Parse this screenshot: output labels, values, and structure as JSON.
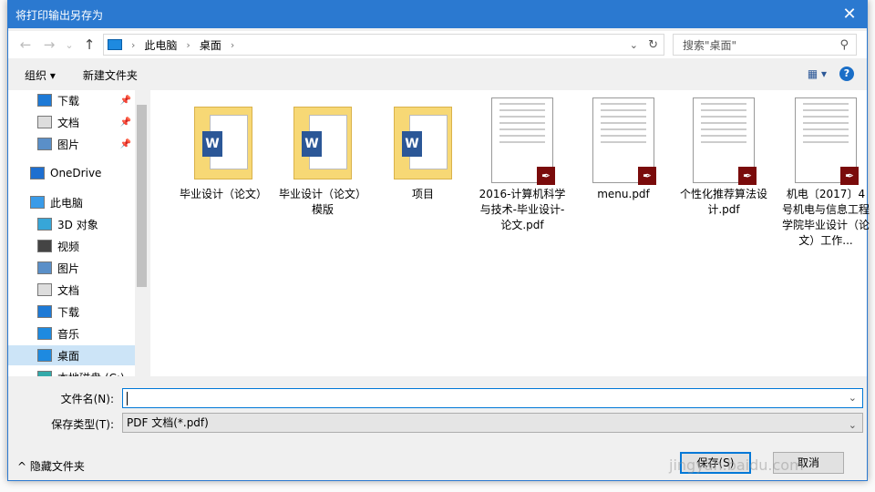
{
  "title": "将打印输出另存为",
  "nav": {
    "back": "←",
    "forward": "→",
    "recent": "⌄",
    "up": "↑",
    "breadcrumb": [
      "此电脑",
      "桌面"
    ],
    "search_placeholder": "搜索\"桌面\""
  },
  "toolbar": {
    "organize": "组织 ▾",
    "new_folder": "新建文件夹",
    "view": "▦ ▾",
    "help": "?"
  },
  "sidebar": {
    "items": [
      {
        "label": "下载",
        "icon": "download-icon",
        "pinned": true
      },
      {
        "label": "文档",
        "icon": "document-icon",
        "pinned": true
      },
      {
        "label": "图片",
        "icon": "picture-icon",
        "pinned": true
      },
      {
        "label": "OneDrive",
        "icon": "cloud-icon"
      },
      {
        "label": "此电脑",
        "icon": "computer-icon"
      },
      {
        "label": "3D 对象",
        "icon": "cube-icon"
      },
      {
        "label": "视频",
        "icon": "video-icon"
      },
      {
        "label": "图片",
        "icon": "picture-icon"
      },
      {
        "label": "文档",
        "icon": "document-icon"
      },
      {
        "label": "下载",
        "icon": "download-icon"
      },
      {
        "label": "音乐",
        "icon": "music-icon"
      },
      {
        "label": "桌面",
        "icon": "desktop-icon",
        "selected": true
      },
      {
        "label": "本地磁盘 (C:)",
        "icon": "drive-icon"
      }
    ]
  },
  "files": [
    {
      "name": "毕业设计（论文）",
      "type": "folder"
    },
    {
      "name": "毕业设计（论文）模版",
      "type": "folder"
    },
    {
      "name": "项目",
      "type": "folder"
    },
    {
      "name": "2016-计算机科学与技术-毕业设计-论文.pdf",
      "type": "pdf"
    },
    {
      "name": "menu.pdf",
      "type": "pdf"
    },
    {
      "name": "个性化推荐算法设计.pdf",
      "type": "pdf"
    },
    {
      "name": "机电〔2017〕4号机电与信息工程学院毕业设计（论文）工作...",
      "type": "pdf"
    }
  ],
  "form": {
    "filename_label": "文件名(N):",
    "filename_value": "",
    "filetype_label": "保存类型(T):",
    "filetype_value": "PDF 文档(*.pdf)"
  },
  "hide_folders": "隐藏文件夹",
  "save": "保存(S)",
  "cancel": "取消",
  "watermark": "jingyan.baidu.com"
}
